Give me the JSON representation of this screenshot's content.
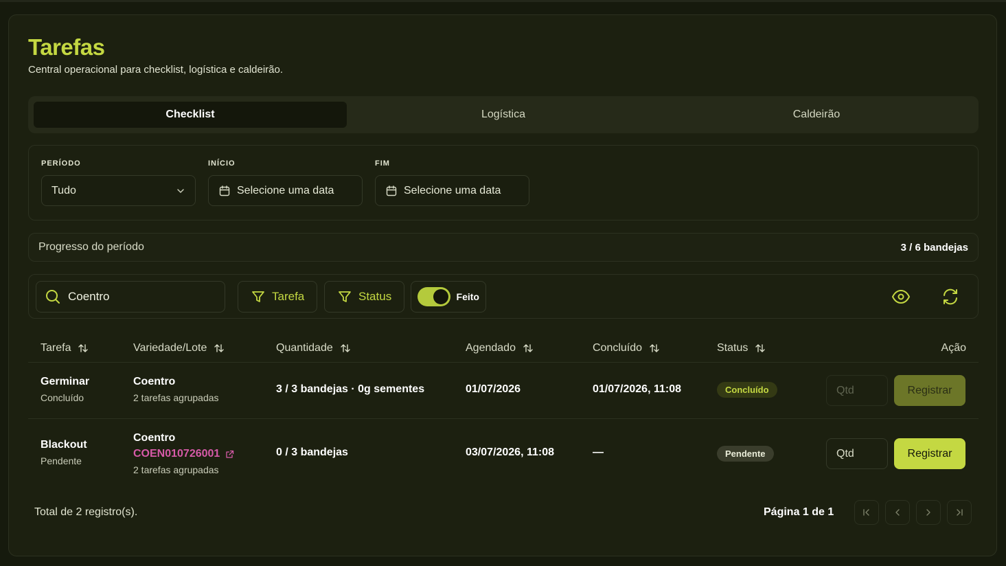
{
  "header": {
    "title": "Tarefas",
    "subtitle": "Central operacional para checklist, logística e caldeirão."
  },
  "tabs": [
    {
      "label": "Checklist",
      "active": true
    },
    {
      "label": "Logística",
      "active": false
    },
    {
      "label": "Caldeirão",
      "active": false
    }
  ],
  "filters": {
    "periodo": {
      "label": "PERÍODO",
      "value": "Tudo"
    },
    "inicio": {
      "label": "INÍCIO",
      "placeholder": "Selecione uma data"
    },
    "fim": {
      "label": "FIM",
      "placeholder": "Selecione uma data"
    }
  },
  "progress": {
    "label": "Progresso do período",
    "value": "3 / 6 bandejas"
  },
  "toolbar": {
    "search_value": "Coentro",
    "tarefa_filter": "Tarefa",
    "status_filter": "Status",
    "toggle_label": "Feito",
    "toggle_on": true
  },
  "table": {
    "columns": [
      "Tarefa",
      "Variedade/Lote",
      "Quantidade",
      "Agendado",
      "Concluído",
      "Status",
      "Ação"
    ],
    "rows": [
      {
        "tarefa": "Germinar",
        "tarefa_status": "Concluído",
        "variedade": "Coentro",
        "lote": "",
        "agrupadas": "2 tarefas agrupadas",
        "quantidade": "3 / 3 bandejas · 0g sementes",
        "agendado": "01/07/2026",
        "concluido": "01/07/2026, 11:08",
        "status": "Concluído",
        "qtd_placeholder": "Qtd",
        "action": "Registrar"
      },
      {
        "tarefa": "Blackout",
        "tarefa_status": "Pendente",
        "variedade": "Coentro",
        "lote": "COEN010726001",
        "agrupadas": "2 tarefas agrupadas",
        "quantidade": "0 / 3 bandejas",
        "agendado": "03/07/2026, 11:08",
        "concluido": "—",
        "status": "Pendente",
        "qtd_placeholder": "Qtd",
        "action": "Registrar"
      }
    ]
  },
  "footer": {
    "total": "Total de 2 registro(s).",
    "page": "Página 1 de 1"
  },
  "colors": {
    "accent": "#c4d842",
    "background": "#161a0d",
    "card": "#1c2010",
    "lote_link": "#d65aa8"
  }
}
